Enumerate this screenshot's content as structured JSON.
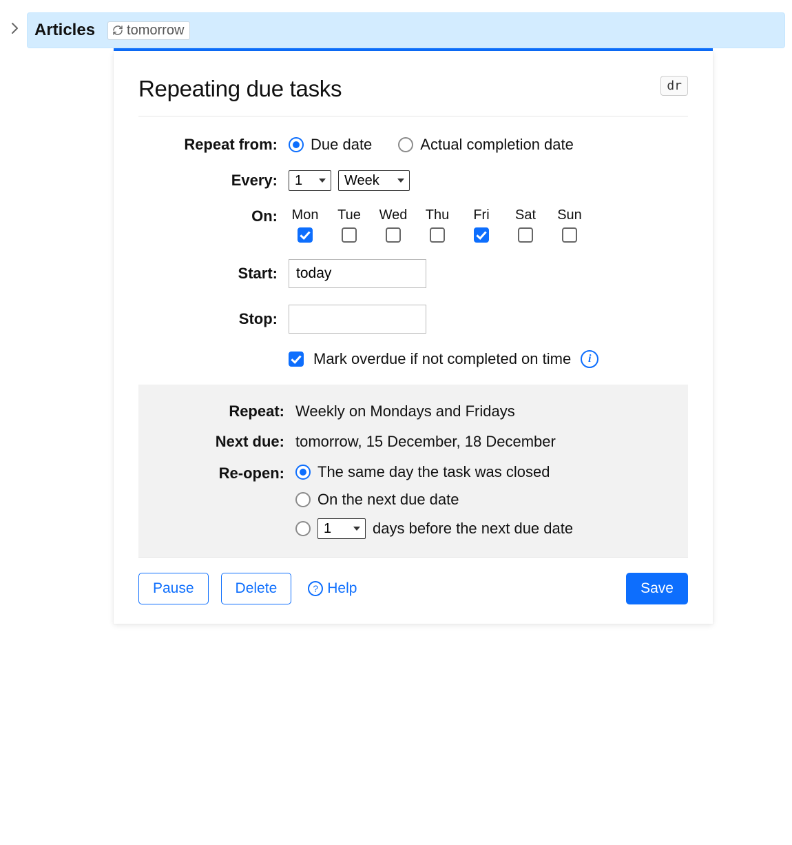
{
  "header": {
    "title": "Articles",
    "token_label": "tomorrow"
  },
  "panel": {
    "title": "Repeating due tasks",
    "shortcut": "dr"
  },
  "form": {
    "repeat_from": {
      "label": "Repeat from:",
      "options": [
        "Due date",
        "Actual completion date"
      ],
      "selected_index": 0
    },
    "every": {
      "label": "Every:",
      "count_value": "1",
      "unit_value": "Week",
      "count_options": [
        "1"
      ],
      "unit_options": [
        "Week"
      ]
    },
    "on": {
      "label": "On:",
      "days": [
        {
          "label": "Mon",
          "checked": true
        },
        {
          "label": "Tue",
          "checked": false
        },
        {
          "label": "Wed",
          "checked": false
        },
        {
          "label": "Thu",
          "checked": false
        },
        {
          "label": "Fri",
          "checked": true
        },
        {
          "label": "Sat",
          "checked": false
        },
        {
          "label": "Sun",
          "checked": false
        }
      ]
    },
    "start": {
      "label": "Start:",
      "value": "today"
    },
    "stop": {
      "label": "Stop:",
      "value": ""
    },
    "overdue": {
      "checked": true,
      "label": "Mark overdue if not completed on time"
    }
  },
  "summary": {
    "repeat": {
      "label": "Repeat:",
      "value": "Weekly on Mondays and Fridays"
    },
    "next_due": {
      "label": "Next due:",
      "value": "tomorrow, 15 December, 18 December"
    },
    "reopen": {
      "label": "Re-open:",
      "options": {
        "same_day": "The same day the task was closed",
        "next_due": "On the next due date",
        "days_before_count": "1",
        "days_before_suffix": "days before the next due date"
      },
      "selected_index": 0
    }
  },
  "footer": {
    "pause": "Pause",
    "delete": "Delete",
    "help": "Help",
    "save": "Save"
  }
}
